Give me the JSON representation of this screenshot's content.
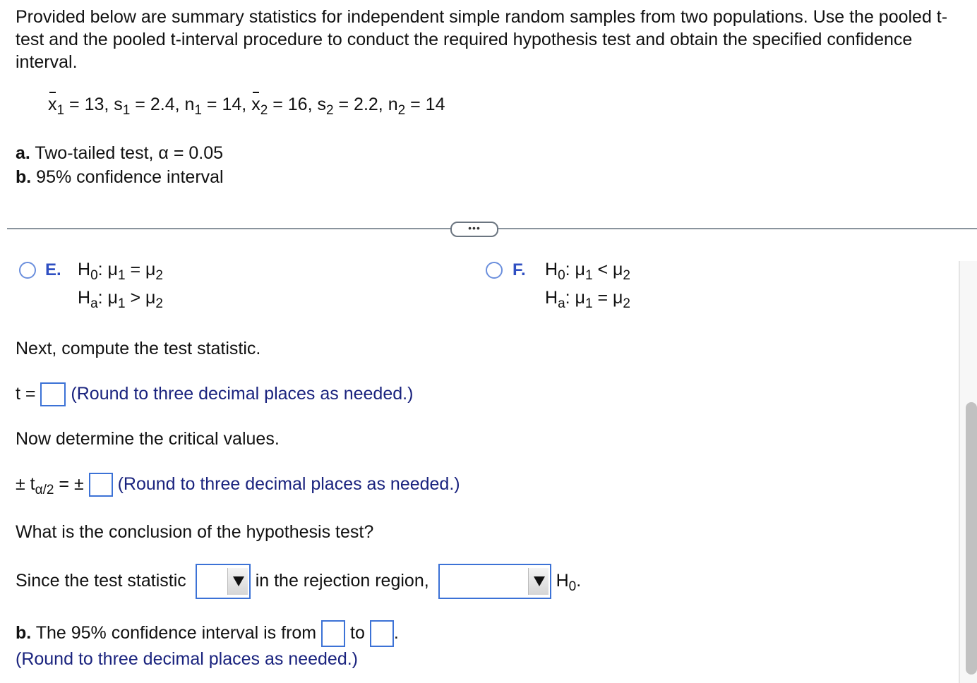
{
  "intro": "Provided below are summary statistics for independent simple random samples from two populations. Use the pooled t-test and the pooled t-interval procedure to conduct the required hypothesis test and obtain the specified confidence interval.",
  "given": {
    "x1_label": "x",
    "x1_sub": "1",
    "x1_value": "= 13, ",
    "s1_label": "s",
    "s1_sub": "1",
    "s1_value": " = 2.4, ",
    "n1_label": "n",
    "n1_sub": "1",
    "n1_value": " = 14, ",
    "x2_label": "x",
    "x2_sub": "2",
    "x2_value": " = 16, ",
    "s2_label": "s",
    "s2_sub": "2",
    "s2_value": " = 2.2, ",
    "n2_label": "n",
    "n2_sub": "2",
    "n2_value": " = 14"
  },
  "parts": {
    "a_label": "a.",
    "a_text": " Two-tailed test, α = 0.05",
    "b_label": "b.",
    "b_text": " 95% confidence interval"
  },
  "more_button": "•••",
  "options": [
    {
      "letter": "E.",
      "h0": "H",
      "h0_sub": "0",
      "h0_rel": ": μ",
      "h0_s1": "1",
      "h0_op": " = μ",
      "h0_s2": "2",
      "ha": "H",
      "ha_sub": "a",
      "ha_rel": ": μ",
      "ha_s1": "1",
      "ha_op": " > μ",
      "ha_s2": "2"
    },
    {
      "letter": "F.",
      "h0": "H",
      "h0_sub": "0",
      "h0_rel": ": μ",
      "h0_s1": "1",
      "h0_op": " < μ",
      "h0_s2": "2",
      "ha": "H",
      "ha_sub": "a",
      "ha_rel": ": μ",
      "ha_s1": "1",
      "ha_op": " = μ",
      "ha_s2": "2"
    }
  ],
  "test_stat": {
    "heading": "Next, compute the test statistic.",
    "label": "t =",
    "value": "",
    "hint": "(Round to three decimal places as needed.)"
  },
  "critical": {
    "heading": "Now determine the critical values.",
    "label_pm": "± t",
    "label_sub": "α/2",
    "label_eq": " = ±",
    "value": "",
    "hint": "(Round to three decimal places as needed.)"
  },
  "conclusion": {
    "heading": "What is the conclusion of the hypothesis test?",
    "prefix": "Since the test statistic",
    "select1_value": "",
    "middle": "in the rejection region,",
    "select2_value": "",
    "suffix": "H",
    "suffix_sub": "0",
    "suffix_end": "."
  },
  "interval": {
    "label": "b.",
    "text": " The 95% confidence interval is from",
    "from_value": "",
    "to": "to",
    "to_value": "",
    "end": ".",
    "hint": "(Round to three decimal places as needed.)"
  }
}
